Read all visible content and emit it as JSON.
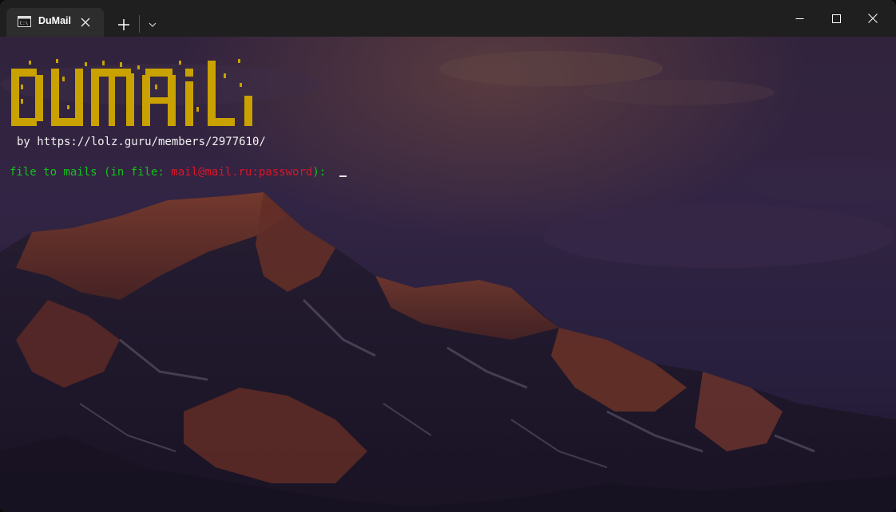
{
  "window": {
    "tab_title": "DuMail",
    "tab_icon": "terminal-icon"
  },
  "terminal": {
    "logo_text": "DuMail",
    "byline": "by https://lolz.guru/members/2977610/",
    "prompt_prefix": "file to mails (in file: ",
    "prompt_format": "mail@mail.ru:password",
    "prompt_suffix": "): "
  },
  "colors": {
    "logo": "#c9a100",
    "prompt_green": "#14c21a",
    "prompt_red": "#d8162a",
    "titlebar": "#1f1f1f",
    "tab": "#2d2d2d"
  }
}
